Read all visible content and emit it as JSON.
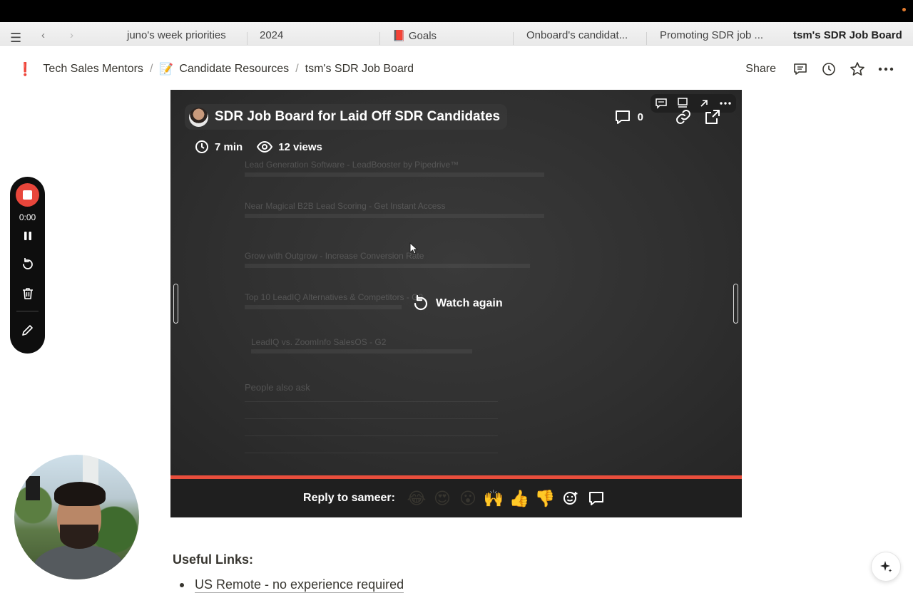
{
  "tabs": [
    {
      "label": "juno's week priorities"
    },
    {
      "label": "2024"
    },
    {
      "label": "Goals",
      "icon": "📕"
    },
    {
      "label": "Onboard's candidat..."
    },
    {
      "label": "Promoting SDR job ..."
    },
    {
      "label": "tsm's SDR Job Board",
      "active": true
    }
  ],
  "breadcrumb": [
    {
      "label": "Tech Sales Mentors",
      "icon": "❗"
    },
    {
      "label": "Candidate Resources",
      "icon": "📝"
    },
    {
      "label": "tsm's SDR Job Board"
    }
  ],
  "breadcrumb_sep": "/",
  "header_actions": {
    "share": "Share",
    "icons": [
      "comment-icon",
      "clock-icon",
      "star-icon",
      "more-icon"
    ]
  },
  "video": {
    "title": "SDR Job Board for Laid Off SDR Candidates",
    "duration": "7 min",
    "views": "12 views",
    "comments": "0",
    "watch_again": "Watch again",
    "reply_label": "Reply to sameer:",
    "reactions": [
      "😂",
      "😍",
      "😮",
      "🙌",
      "👍",
      "👎"
    ],
    "progress": 1.0,
    "accent": "#e94e3c",
    "bg_text": [
      "Lead Generation Software - LeadBooster by Pipedrive™",
      "Near Magical B2B Lead Scoring - Get Instant Access",
      "Grow with Outgrow - Increase Conversion Rate",
      "Top 10 LeadIQ Alternatives & Competitors - G2",
      "LeadIQ vs. ZoomInfo SalesOS - G2",
      "People also ask"
    ]
  },
  "recorder": {
    "time": "0:00",
    "accent": "#e8463b"
  },
  "content": {
    "heading": "Useful Links:",
    "bullets": [
      "US Remote - no experience required"
    ]
  }
}
